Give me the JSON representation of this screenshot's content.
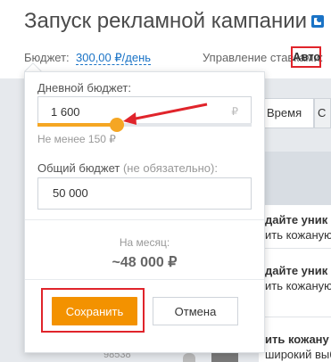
{
  "page": {
    "title": "Запуск рекламной кампании",
    "budget_label": "Бюджет:",
    "budget_value": "300,00 ₽/день",
    "bid_label": "Управление ставками:",
    "bid_value": "Авто"
  },
  "background": {
    "tab_time": "Время",
    "tab_next": "С",
    "row1_line1": "дайте уник",
    "row1_line2": "ить кожаную",
    "row2_line1": "дайте уник",
    "row2_line2": "ить кожаную",
    "row3_line1": "ить кожану",
    "row3_line2": "широкий выб",
    "row_number": "98538"
  },
  "popup": {
    "daily_label": "Дневной бюджет:",
    "daily_value": "1 600",
    "currency_symbol": "₽",
    "slider_fraction": 0.37,
    "min_hint": "Не менее 150 ₽",
    "total_label": "Общий бюджет",
    "total_optional": "(не обязательно):",
    "total_value": "50 000",
    "monthly_label": "На месяц:",
    "monthly_value": "~48 000 ₽",
    "save_label": "Сохранить",
    "cancel_label": "Отмена"
  },
  "colors": {
    "accent": "#f39200",
    "slider": "#f5a623",
    "link": "#1a73c6",
    "annotation": "#e0242b"
  }
}
